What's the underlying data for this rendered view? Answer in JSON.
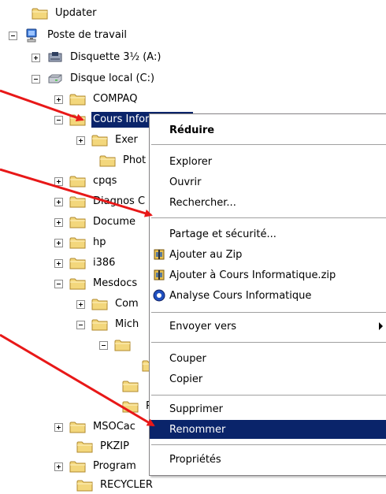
{
  "tree": {
    "updater": "Updater",
    "poste": "Poste de travail",
    "disquette": "Disquette 3½ (A:)",
    "disque": "Disque local (C:)",
    "compaq": "COMPAQ",
    "cours": "Cours Informatique",
    "exer": "Exer",
    "phot1": "Phot",
    "cpqs": "cpqs",
    "diagnos": "Diagnos C",
    "docume": "Docume",
    "hp": "hp",
    "i386": "i386",
    "mesdocs": "Mesdocs",
    "com": "Com",
    "mich": "Mich",
    "phot2": "Phot",
    "msocac": "MSOCac",
    "pkzip": "PKZIP",
    "program": "Program",
    "recycler": "RECYCLER"
  },
  "menu": {
    "reduire": "Réduire",
    "explorer": "Explorer",
    "ouvrir": "Ouvrir",
    "rechercher": "Rechercher...",
    "partage": "Partage et sécurité...",
    "ajouter_zip": "Ajouter au Zip",
    "ajouter_cours_zip": "Ajouter à Cours Informatique.zip",
    "analyse": "Analyse Cours Informatique",
    "envoyer": "Envoyer vers",
    "couper": "Couper",
    "copier": "Copier",
    "supprimer": "Supprimer",
    "renommer": "Renommer",
    "proprietes": "Propriétés"
  },
  "colors": {
    "selection": "#0a246a",
    "arrow": "#e81818",
    "folder": "#f3d77c"
  }
}
